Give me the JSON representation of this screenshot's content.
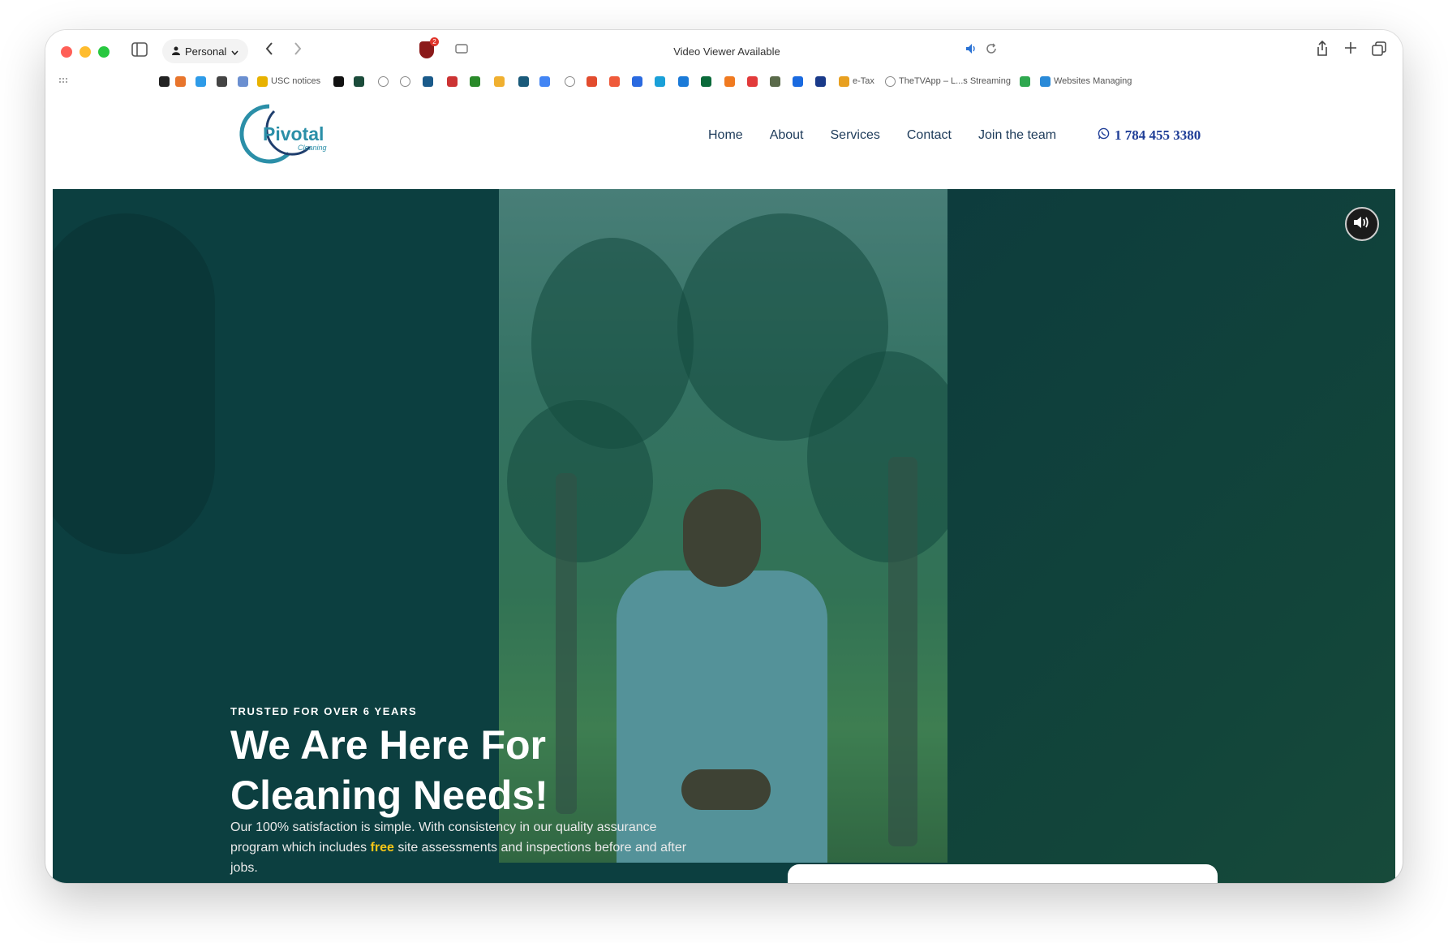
{
  "browser": {
    "profile_label": "Personal",
    "address_text": "Video Viewer Available",
    "shield_count": "2",
    "bookmarks": [
      {
        "label": "",
        "icon": "apple-icon"
      },
      {
        "label": "",
        "icon": "zapier-icon"
      },
      {
        "label": "",
        "icon": "microsoft-icon"
      },
      {
        "label": "",
        "icon": "script-icon"
      },
      {
        "label": "",
        "icon": "lock-icon"
      },
      {
        "label": "USC notices",
        "icon": "usc-icon"
      },
      {
        "label": "",
        "icon": "b-icon"
      },
      {
        "label": "",
        "icon": "doc-icon"
      },
      {
        "label": "",
        "icon": "globe-icon"
      },
      {
        "label": "",
        "icon": "globe-icon"
      },
      {
        "label": "",
        "icon": "circle-icon"
      },
      {
        "label": "",
        "icon": "ubc-icon"
      },
      {
        "label": "",
        "icon": "green-icon"
      },
      {
        "label": "",
        "icon": "sun-icon"
      },
      {
        "label": "",
        "icon": "th-icon"
      },
      {
        "label": "",
        "icon": "google-icon"
      },
      {
        "label": "",
        "icon": "globe-icon"
      },
      {
        "label": "",
        "icon": "git-icon"
      },
      {
        "label": "",
        "icon": "chart-icon"
      },
      {
        "label": "",
        "icon": "app-icon"
      },
      {
        "label": "",
        "icon": "p-icon"
      },
      {
        "label": "",
        "icon": "iq-icon"
      },
      {
        "label": "",
        "icon": "s-icon"
      },
      {
        "label": "",
        "icon": "box-icon"
      },
      {
        "label": "",
        "icon": "grid-icon"
      },
      {
        "label": "",
        "icon": "turtle-icon"
      },
      {
        "label": "",
        "icon": "t-icon"
      },
      {
        "label": "",
        "icon": "bug-icon"
      },
      {
        "label": "e-Tax",
        "icon": "etax-icon"
      },
      {
        "label": "TheTVApp – L...s Streaming",
        "icon": "globe-icon"
      },
      {
        "label": "",
        "icon": "dot-icon"
      },
      {
        "label": "Websites Managing",
        "icon": "cloud-icon"
      }
    ]
  },
  "site": {
    "logo_text": "Pivotal",
    "logo_sub": "Cleaning",
    "nav": [
      "Home",
      "About",
      "Services",
      "Contact",
      "Join the team"
    ],
    "phone": "1 784 455 3380",
    "hero": {
      "eyebrow": "TRUSTED FOR OVER 6 YEARS",
      "headline": "We Are Here For Cleaning Needs!",
      "lede_before": "Our 100% satisfaction is simple. With consistency in our quality assurance program which includes ",
      "lede_highlight": "free",
      "lede_after": " site assessments and inspections before and after jobs."
    }
  },
  "colors": {
    "hero_bg": "#0c3f40",
    "nav_text": "#1d3b5a",
    "phone": "#1f3e97",
    "highlight": "#f5c518",
    "logo": "#2b8fa8"
  }
}
